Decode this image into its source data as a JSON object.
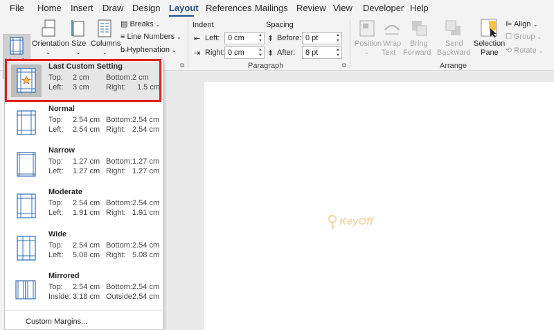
{
  "menu": {
    "tabs": [
      "File",
      "Home",
      "Insert",
      "Draw",
      "Design",
      "Layout",
      "References",
      "Mailings",
      "Review",
      "View",
      "Developer",
      "Help"
    ],
    "active": "Layout"
  },
  "ribbon": {
    "page_setup": {
      "margins": "Margins",
      "orientation": "Orientation",
      "size": "Size",
      "columns": "Columns",
      "breaks": "Breaks",
      "line_numbers": "Line Numbers",
      "hyphenation": "Hyphenation"
    },
    "paragraph": {
      "indent_label": "Indent",
      "spacing_label": "Spacing",
      "left_label": "Left:",
      "left_value": "0 cm",
      "right_label": "Right:",
      "right_value": "0 cm",
      "before_label": "Before:",
      "before_value": "0 pt",
      "after_label": "After:",
      "after_value": "8 pt",
      "group_label": "Paragraph"
    },
    "arrange": {
      "position": "Position",
      "wrap_text_1": "Wrap",
      "wrap_text_2": "Text",
      "bring_forward_1": "Bring",
      "bring_forward_2": "Forward",
      "send_backward_1": "Send",
      "send_backward_2": "Backward",
      "selection_pane_1": "Selection",
      "selection_pane_2": "Pane",
      "align": "Align",
      "group": "Group",
      "rotate": "Rotate",
      "group_label": "Arrange"
    }
  },
  "margins_menu": {
    "presets": [
      {
        "name": "Last Custom Setting",
        "top_label": "Top:",
        "top": "2 cm",
        "bottom_label": "Bottom:",
        "bottom": "2 cm",
        "left_label": "Left:",
        "left": "3 cm",
        "right_label": "Right:",
        "right": "1.5 cm"
      },
      {
        "name": "Normal",
        "top_label": "Top:",
        "top": "2.54 cm",
        "bottom_label": "Bottom:",
        "bottom": "2.54 cm",
        "left_label": "Left:",
        "left": "2.54 cm",
        "right_label": "Right:",
        "right": "2.54 cm"
      },
      {
        "name": "Narrow",
        "top_label": "Top:",
        "top": "1.27 cm",
        "bottom_label": "Bottom:",
        "bottom": "1.27 cm",
        "left_label": "Left:",
        "left": "1.27 cm",
        "right_label": "Right:",
        "right": "1.27 cm"
      },
      {
        "name": "Moderate",
        "top_label": "Top:",
        "top": "2.54 cm",
        "bottom_label": "Bottom:",
        "bottom": "2.54 cm",
        "left_label": "Left:",
        "left": "1.91 cm",
        "right_label": "Right:",
        "right": "1.91 cm"
      },
      {
        "name": "Wide",
        "top_label": "Top:",
        "top": "2.54 cm",
        "bottom_label": "Bottom:",
        "bottom": "2.54 cm",
        "left_label": "Left:",
        "left": "5.08 cm",
        "right_label": "Right:",
        "right": "5.08 cm"
      },
      {
        "name": "Mirrored",
        "top_label": "Top:",
        "top": "2.54 cm",
        "bottom_label": "Bottom:",
        "bottom": "2.54 cm",
        "left_label": "Inside:",
        "left": "3.18 cm",
        "right_label": "Outside:",
        "right": "2.54 cm"
      }
    ],
    "custom_margins": "Custom Margins..."
  },
  "watermark": {
    "text": "KeyOff"
  },
  "colors": {
    "accent": "#1e4e8c",
    "highlight": "#e01e1e",
    "icon_blue": "#2b6cb0"
  }
}
